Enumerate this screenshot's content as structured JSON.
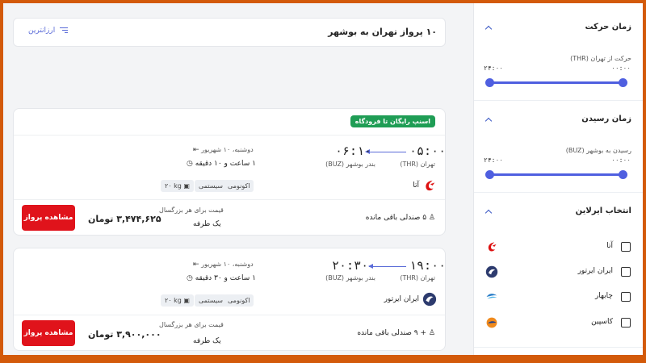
{
  "header": {
    "title": "۱۰ پرواز تهران به بوشهر",
    "sort_label": "ارزانترین"
  },
  "flights": [
    {
      "promo": "اسنپ رایگان تا فرودگاه",
      "depart_time": "۰۵:۰۰",
      "arrive_time": "۰۶:۱۰",
      "origin": "تهران (THR)",
      "destination": "بندر بوشهر (BUZ)",
      "date": "دوشنبه، ۱۰ شهریور",
      "duration": "۱ ساعت و ۱۰ دقیقه",
      "airline": "آتا",
      "class": "اکونومی",
      "type": "سیستمی",
      "baggage": "۲۰ kg",
      "seats": "۵ صندلی باقی مانده",
      "price_label": "قیمت برای هر بزرگسال",
      "price": "۳,۴۷۴,۶۲۵ تومان",
      "trip": "یک طرفه",
      "cta": "مشاهده پرواز"
    },
    {
      "depart_time": "۱۹:۰۰",
      "arrive_time": "۲۰:۳۰",
      "origin": "تهران (THR)",
      "destination": "بندر بوشهر (BUZ)",
      "date": "دوشنبه، ۱۰ شهریور",
      "duration": "۱ ساعت و ۳۰ دقیقه",
      "airline": "ایران ایرتور",
      "class": "اکونومی",
      "type": "سیستمی",
      "baggage": "۲۰ kg",
      "seats": "+ ۹ صندلی باقی مانده",
      "price_label": "قیمت برای هر بزرگسال",
      "price": "۳,۹۰۰,۰۰۰ تومان",
      "trip": "یک طرفه",
      "cta": "مشاهده پرواز"
    }
  ],
  "filters": {
    "departure": {
      "title": "زمان حرکت",
      "label": "حرکت از تهران (THR)",
      "min": "۰۰:۰۰",
      "max": "۲۴:۰۰"
    },
    "arrival": {
      "title": "زمان رسیدن",
      "label": "رسیدن به بوشهر (BUZ)",
      "min": "۰۰:۰۰",
      "max": "۲۴:۰۰"
    },
    "airlines": {
      "title": "انتخاب ایرلاین",
      "items": [
        "آتا",
        "ایران ایرتور",
        "چابهار",
        "کاسپین"
      ]
    }
  },
  "colors": {
    "accent": "#4f5fe0",
    "cta": "#e0131b",
    "promo": "#1f9d55",
    "page_border": "#d35a0a"
  }
}
